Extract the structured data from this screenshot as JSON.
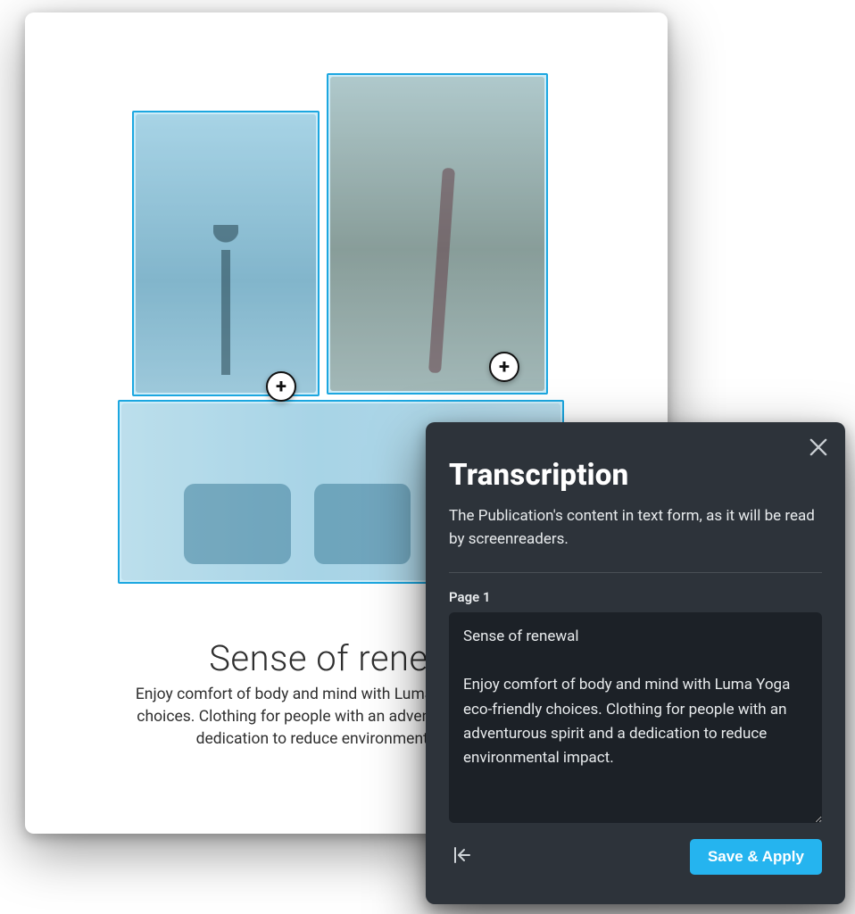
{
  "document": {
    "title": "Sense of renewal",
    "body": "Enjoy comfort of body and mind with Luma Yoga eco-friendly choices. Clothing for people with an adventurous spirit and a dedication to reduce environmental impact.",
    "add_icon_glyph": "+"
  },
  "panel": {
    "title": "Transcription",
    "description": "The Publication's content in text form, as it will be read by screenreaders.",
    "page_label": "Page 1",
    "textarea_value": "Sense of renewal\n\nEnjoy comfort of body and mind with Luma Yoga eco-friendly choices. Clothing for people with an adventurous spirit and a dedication to reduce environmental impact.",
    "save_label": "Save & Apply"
  },
  "colors": {
    "selection_border": "#1ca7e0",
    "panel_bg": "#2d333a",
    "textarea_bg": "#1c2127",
    "accent": "#25b4ef"
  }
}
